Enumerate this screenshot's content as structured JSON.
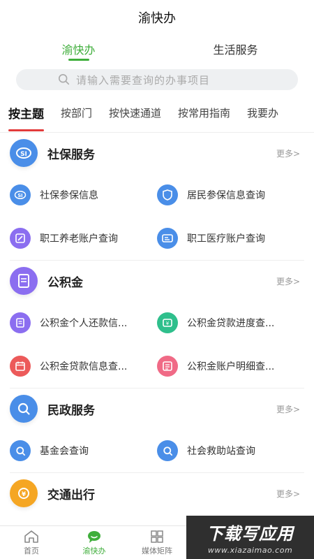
{
  "header": {
    "title": "渝快办"
  },
  "top_tabs": [
    {
      "label": "渝快办",
      "active": true
    },
    {
      "label": "生活服务",
      "active": false
    }
  ],
  "search": {
    "placeholder": "请输入需要查询的办事项目"
  },
  "sub_tabs": [
    "按主题",
    "按部门",
    "按快速通道",
    "按常用指南",
    "我要办"
  ],
  "sections": [
    {
      "title": "社保服务",
      "more": "更多>",
      "icon": "social-security-icon",
      "items": [
        {
          "label": "社保参保信息",
          "icon": "social-security-icon"
        },
        {
          "label": "居民参保信息查询",
          "icon": "shield-icon"
        },
        {
          "label": "职工养老账户查询",
          "icon": "edit-document-icon"
        },
        {
          "label": "职工医疗账户查询",
          "icon": "id-card-icon"
        }
      ]
    },
    {
      "title": "公积金",
      "more": "更多>",
      "icon": "document-icon",
      "items": [
        {
          "label": "公积金个人还款信...",
          "icon": "document-icon"
        },
        {
          "label": "公积金贷款进度查...",
          "icon": "loan-icon"
        },
        {
          "label": "公积金贷款信息查...",
          "icon": "calendar-icon"
        },
        {
          "label": "公积金账户明细查...",
          "icon": "list-icon"
        }
      ]
    },
    {
      "title": "民政服务",
      "more": "更多>",
      "icon": "search-icon",
      "items": [
        {
          "label": "基金会查询",
          "icon": "search-icon"
        },
        {
          "label": "社会救助站查询",
          "icon": "search-icon"
        }
      ]
    },
    {
      "title": "交通出行",
      "more": "更多>",
      "icon": "fine-icon",
      "items": []
    }
  ],
  "bottom_nav": [
    {
      "label": "首页",
      "icon": "home-icon",
      "active": false
    },
    {
      "label": "渝快办",
      "icon": "chat-bubble-icon",
      "active": true
    },
    {
      "label": "媒体矩阵",
      "icon": "grid-icon",
      "active": false
    }
  ],
  "watermark": {
    "main": "下载写应用",
    "sub": "www.xiazaimao.com"
  },
  "colors": {
    "accent": "#3fae3b",
    "tab_underline": "#e23b3b",
    "blue": "#4a8ee8",
    "purple": "#8b6ef0",
    "green": "#2fbf8c",
    "red": "#ec5a5a",
    "pink": "#f06a86",
    "orange": "#f5a623"
  }
}
